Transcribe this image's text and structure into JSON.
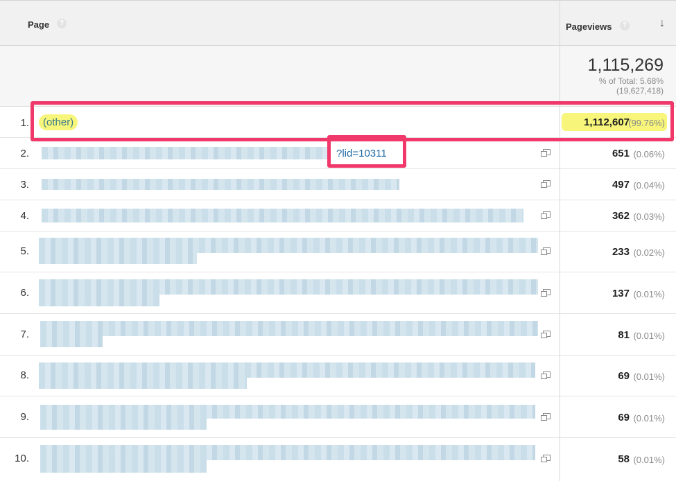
{
  "header": {
    "page_label": "Page",
    "pageviews_label": "Pageviews",
    "help_glyph": "?",
    "sort_icon": "arrow-down-icon"
  },
  "totals": {
    "value": "1,115,269",
    "pct_label": "% of Total: 5.68%",
    "total_of": "(19,627,418)"
  },
  "rows": [
    {
      "index": "1.",
      "page": "(other)",
      "pageviews": "1,112,607",
      "pct": "(99.76%)"
    },
    {
      "index": "2.",
      "page_suffix": "?lid=10311",
      "pageviews": "651",
      "pct": "(0.06%)"
    },
    {
      "index": "3.",
      "pageviews": "497",
      "pct": "(0.04%)"
    },
    {
      "index": "4.",
      "pageviews": "362",
      "pct": "(0.03%)"
    },
    {
      "index": "5.",
      "pageviews": "233",
      "pct": "(0.02%)"
    },
    {
      "index": "6.",
      "pageviews": "137",
      "pct": "(0.01%)"
    },
    {
      "index": "7.",
      "pageviews": "81",
      "pct": "(0.01%)"
    },
    {
      "index": "8.",
      "pageviews": "69",
      "pct": "(0.01%)"
    },
    {
      "index": "9.",
      "pageviews": "69",
      "pct": "(0.01%)"
    },
    {
      "index": "10.",
      "pageviews": "58",
      "pct": "(0.01%)"
    }
  ],
  "colors": {
    "highlight": "#f7f57a",
    "annotation_box": "#f0386a",
    "link": "#1f6ba5"
  }
}
